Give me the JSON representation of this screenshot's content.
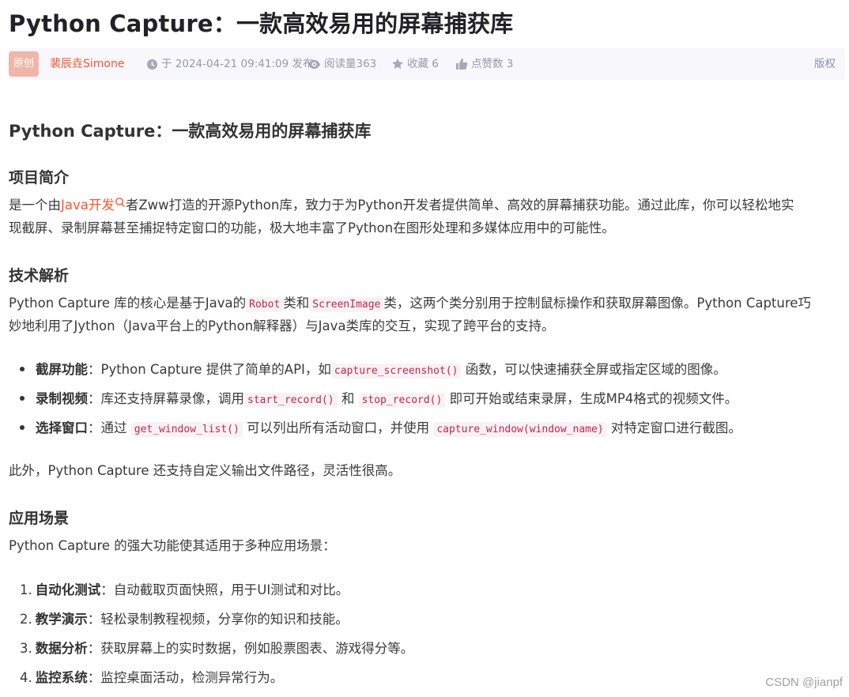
{
  "article": {
    "title": "Python Capture：一款高效易用的屏幕捕获库"
  },
  "meta": {
    "badge": "原创",
    "author": "裴辰垚Simone",
    "time": "于 2024-04-21 09:41:09 发布",
    "read": "阅读量363",
    "fav": "收藏 6",
    "like": "点赞数 3",
    "copyright": "版权"
  },
  "content": {
    "h2": "Python Capture：一款高效易用的屏幕捕获库",
    "intro_heading": "项目简介",
    "intro_p1_a": "是一个由",
    "intro_p1_link": "Java开发",
    "intro_p1_b": "者Zww打造的开源Python库，致力于为Python开发者提供简单、高效的屏幕捕获功能。通过此库，你可以轻松地实",
    "intro_p2": "现截屏、录制屏幕甚至捕捉特定窗口的功能，极大地丰富了Python在图形处理和多媒体应用中的可能性。",
    "tech_heading": "技术解析",
    "tech_p1_a": "Python Capture 库的核心是基于Java的",
    "tech_code1": "Robot",
    "tech_p1_b": "类和",
    "tech_code2": "ScreenImage",
    "tech_p1_c": "类，这两个类分别用于控制鼠标操作和获取屏幕图像。Python Capture巧",
    "tech_p2": "妙地利用了Jython（Java平台上的Python解释器）与Java类库的交互，实现了跨平台的支持。",
    "features": [
      {
        "bold": "截屏功能",
        "a": "：Python Capture 提供了简单的API，如",
        "code1": "capture_screenshot()",
        "b": "函数，可以快速捕获全屏或指定区域的图像。",
        "code2": "",
        "c": ""
      },
      {
        "bold": "录制视频",
        "a": "：库还支持屏幕录像，调用",
        "code1": "start_record()",
        "b": "和",
        "code2": "stop_record()",
        "c": "即可开始或结束录屏，生成MP4格式的视频文件。"
      },
      {
        "bold": "选择窗口",
        "a": "：通过",
        "code1": "get_window_list()",
        "b": "可以列出所有活动窗口，并使用",
        "code2": "capture_window(window_name)",
        "c": "对特定窗口进行截图。"
      }
    ],
    "extra": "此外，Python Capture 还支持自定义输出文件路径，灵活性很高。",
    "app_heading": "应用场景",
    "app_intro": "Python Capture 的强大功能使其适用于多种应用场景：",
    "apps": [
      {
        "num": "1.",
        "bold": "自动化测试",
        "text": "：自动截取页面快照，用于UI测试和对比。"
      },
      {
        "num": "2.",
        "bold": "教学演示",
        "text": "：轻松录制教程视频，分享你的知识和技能。"
      },
      {
        "num": "3.",
        "bold": "数据分析",
        "text": "：获取屏幕上的实时数据，例如股票图表、游戏得分等。"
      },
      {
        "num": "4.",
        "bold": "监控系统",
        "text": "：监控桌面活动，检测异常行为。"
      }
    ]
  },
  "watermark": "CSDN @jianpf",
  "colors": {
    "accent": "#fc5531",
    "code": "#c7254e",
    "meta_bg": "#f7f7fc"
  },
  "icons": [
    "clock-icon",
    "eye-icon",
    "star-icon",
    "thumb-up-icon",
    "search-icon"
  ]
}
